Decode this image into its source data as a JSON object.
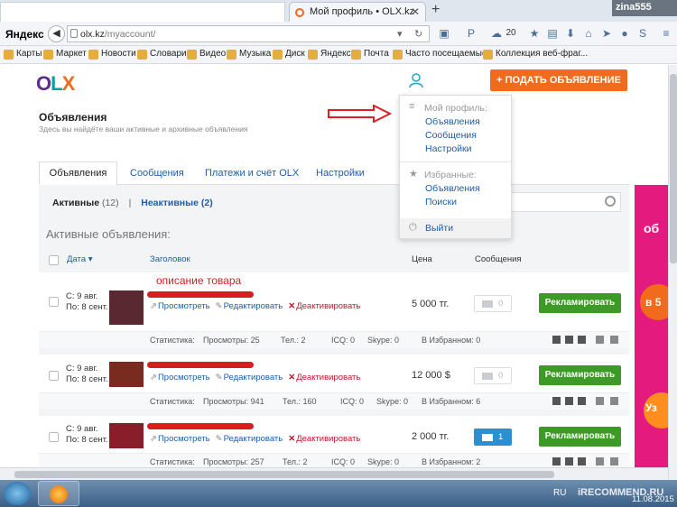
{
  "browser": {
    "tab_title": "Мой профиль • OLX.kz",
    "user": "zina555",
    "brand": "Яндекс",
    "url_host": "olx.kz",
    "url_path": "/myaccount/",
    "weather_temp": "20"
  },
  "bookmarks": [
    "Карты",
    "Маркет",
    "Новости",
    "Словари",
    "Видео",
    "Музыка",
    "Диск",
    "Яндекс",
    "Почта",
    "Часто посещаемые",
    "Коллекция веб-фраг..."
  ],
  "header": {
    "post_ad_button": "+ ПОДАТЬ ОБЪЯВЛЕНИЕ",
    "title": "Объявления",
    "subtitle": "Здесь вы найдёте ваши активные и архивные объявления"
  },
  "dropdown": {
    "profile_header": "Мой профиль:",
    "profile_links": [
      "Объявления",
      "Сообщения",
      "Настройки"
    ],
    "favorites_header": "Избранные:",
    "favorites_links": [
      "Объявления",
      "Поиски"
    ],
    "logout": "Выйти"
  },
  "tabs": [
    "Объявления",
    "Сообщения",
    "Платежи и счёт OLX",
    "Настройки"
  ],
  "filter": {
    "active_label": "Активные",
    "active_count": "(12)",
    "separator": "|",
    "inactive_label": "Неактивные (2)"
  },
  "list": {
    "heading": "Активные объявления:",
    "columns": {
      "date": "Дата",
      "title": "Заголовок",
      "price": "Цена",
      "messages": "Сообщения"
    },
    "annotation": "описание товара",
    "actions": {
      "view": "Просмотреть",
      "edit": "Редактировать",
      "deactivate": "Деактивировать",
      "promote": "Рекламировать"
    },
    "stats_label": "Статистика:",
    "rows": [
      {
        "from": "С: 9 авг.",
        "to": "По: 8 сент.",
        "price": "5 000 тг.",
        "messages": "0",
        "views": "Просмотры: 25",
        "phone": "Тел.: 2",
        "icq": "ICQ: 0",
        "skype": "Skype: 0",
        "favorites": "В Избранном: 0"
      },
      {
        "from": "С: 9 авг.",
        "to": "По: 8 сент.",
        "price": "12 000 $",
        "messages": "0",
        "views": "Просмотры: 941",
        "phone": "Тел.: 160",
        "icq": "ICQ: 0",
        "skype": "Skype: 0",
        "favorites": "В Избранном: 6"
      },
      {
        "from": "С: 9 авг.",
        "to": "По: 8 сент.",
        "price": "2 000 тг.",
        "messages": "1",
        "views": "Просмотры: 257",
        "phone": "Тел.: 2",
        "icq": "ICQ: 0",
        "skype": "Skype: 0",
        "favorites": "В Избранном: 2"
      }
    ]
  },
  "banner": {
    "text1": "об",
    "text2": "в 5",
    "text3": "Уз"
  },
  "taskbar": {
    "lang": "RU",
    "date": "11.08.2015",
    "watermark": "iRECOMMEND.RU"
  }
}
